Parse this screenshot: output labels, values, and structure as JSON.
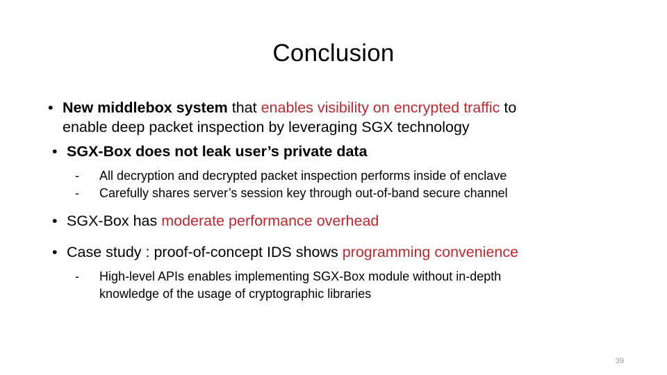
{
  "slide": {
    "title": "Conclusion",
    "page_number": "39",
    "accent_color": "#C0272D",
    "text_color": "#000000",
    "background_color": "#FFFFFF",
    "page_number_color": "#9A9A9A",
    "bullet_marker": "•",
    "dash_marker": "-"
  },
  "content": {
    "bullet1": {
      "line1_part1": "New middlebox system",
      "line1_part2": " that ",
      "line1_part3": "enables visibility on encrypted traffic",
      "line1_part4": " to",
      "line2": "enable deep packet inspection by leveraging SGX technology"
    },
    "bullet2": {
      "text": "SGX-Box does not leak user’s private data",
      "sub1": "All decryption and decrypted packet inspection performs inside of enclave",
      "sub2": "Carefully shares server’s session key through out-of-band secure channel"
    },
    "bullet3": {
      "part1": "SGX-Box has ",
      "part2": "moderate performance overhead"
    },
    "bullet4": {
      "part1": "Case study : proof-of-concept IDS shows ",
      "part2": "programming convenience",
      "sub1_line1": "High-level APIs enables implementing SGX-Box module without in-depth",
      "sub1_line2": "knowledge of the usage of cryptographic libraries"
    }
  }
}
